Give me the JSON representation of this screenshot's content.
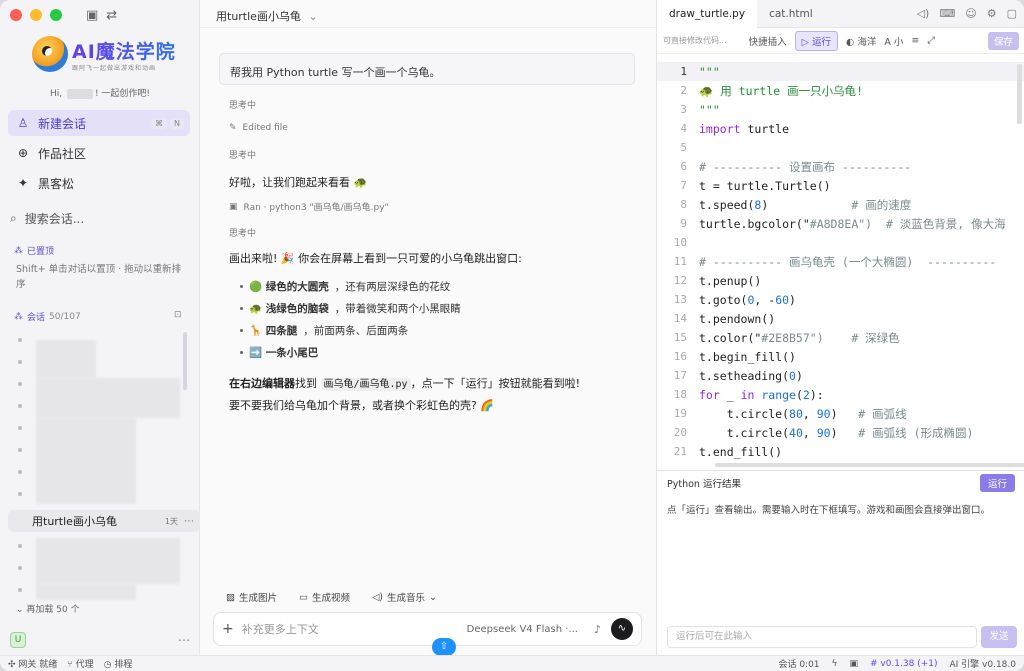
{
  "sidebar": {
    "logo_title": "AI魔法学院",
    "logo_sub": "跟阿飞一起做出游戏和动画",
    "greet_prefix": "Hi, ",
    "greet_suffix": "! 一起创作吧!",
    "nav_new": "新建会话",
    "nav_community": "作品社区",
    "nav_hackathon": "黑客松",
    "kbd1": "⌘",
    "kbd2": "N",
    "search": "搜索会话...",
    "pinned": "已置顶",
    "pin_hint": "Shift+ 单击对话以置顶 · 拖动以重新排序",
    "conversations": "会话",
    "conv_count": "50/107",
    "active_conv": "用turtle画小乌龟",
    "active_time": "1天",
    "load_more": "再加载 50 个",
    "avatar": "U"
  },
  "chat": {
    "title": "用turtle画小乌龟",
    "user_msg": "帮我用 Python turtle 写一个画一个乌龟。",
    "thinking1": "思考中",
    "edited": "Edited file",
    "thinking2": "思考中",
    "msg1": "好啦，让我们跑起来看看 🐢",
    "ran": "Ran · python3 \"画乌龟/画乌龟.py\"",
    "thinking3": "思考中",
    "msg2": "画出来啦! 🎉 你会在屏幕上看到一只可爱的小乌龟跳出窗口:",
    "bullets": [
      {
        "em": "🟢 绿色的大圆壳",
        "rest": "，还有两层深绿色的花纹"
      },
      {
        "em": "🐢 浅绿色的脑袋",
        "rest": "，带着微笑和两个小黑眼睛"
      },
      {
        "em": "🦒 四条腿",
        "rest": "，前面两条、后面两条"
      },
      {
        "em": "➡️ 一条小尾巴",
        "rest": ""
      }
    ],
    "msg3_a": "在右边编辑器",
    "msg3_b": "找到",
    "msg3_code": "画乌龟/画乌龟.py",
    "msg3_c": "，点一下「运行」按钮就能看到啦!",
    "msg4": "要不要我们给乌龟加个背景，或者换个彩虹色的壳? 🌈",
    "tool_image": "生成图片",
    "tool_video": "生成视频",
    "tool_music": "生成音乐",
    "input_placeholder": "补充更多上下文",
    "model": "Deepseek V4 Flash ·..."
  },
  "editor": {
    "tab1": "draw_turtle.py",
    "tab2": "cat.html",
    "hint": "可直接修改代码...",
    "quick_insert": "快捷插入",
    "run": "▷ 运行",
    "theme": "海洋",
    "font": "小",
    "save": "保存",
    "lines": [
      "\"\"\"",
      "🐢 用 turtle 画一只小乌龟!",
      "\"\"\"",
      "import turtle",
      "",
      "# ---------- 设置画布 ----------",
      "t = turtle.Turtle()",
      "t.speed(8)            # 画的速度",
      "turtle.bgcolor(\"#A8D8EA\")  # 淡蓝色背景, 像大海",
      "",
      "# ---------- 画乌龟壳 (一个大椭圆)  ----------",
      "t.penup()",
      "t.goto(0, -60)",
      "t.pendown()",
      "t.color(\"#2E8B57\")    # 深绿色",
      "t.begin_fill()",
      "t.setheading(0)",
      "for _ in range(2):",
      "    t.circle(80, 90)   # 画弧线",
      "    t.circle(40, 90)   # 画弧线 (形成椭圆)",
      "t.end_fill()"
    ],
    "output_title": "Python 运行结果",
    "output_run": "运行",
    "output_msg": "点「运行」查看输出。需要输入时在下框填写。游戏和画图会直接弹出窗口。",
    "input_placeholder": "运行后可在此输入",
    "send": "发送"
  },
  "status": {
    "network": "网关 就绪",
    "proxy": "代理",
    "ranking": "排程",
    "session_time": "会话 0:01",
    "version": "v0.1.38 (+1)",
    "engine": "AI 引擎 v0.18.0"
  }
}
